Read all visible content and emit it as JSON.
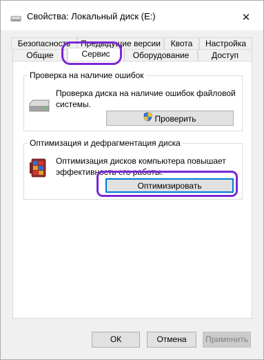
{
  "window": {
    "title": "Свойства: Локальный диск (E:)",
    "close_glyph": "✕"
  },
  "tabs": {
    "row1": [
      "Безопасность",
      "Предыдущие версии",
      "Квота",
      "Настройка"
    ],
    "row2": [
      "Общие",
      "Сервис",
      "Оборудование",
      "Доступ"
    ],
    "active": "Сервис"
  },
  "error_check": {
    "title": "Проверка на наличие ошибок",
    "description_line1": "Проверка диска на наличие ошибок файловой",
    "description_line2": "системы.",
    "button_label": "Проверить",
    "icon": "drive-icon",
    "button_icon": "uac-shield-icon"
  },
  "optimize": {
    "title": "Оптимизация и дефрагментация диска",
    "description_line1": "Оптимизация дисков компьютера повышает",
    "description_line2": "эффективность его работы.",
    "button_label": "Оптимизировать",
    "icon": "defrag-icon"
  },
  "footer": {
    "ok_label": "ОК",
    "cancel_label": "Отмена",
    "apply_label": "Применить"
  },
  "colors": {
    "highlight": "#7a26d8",
    "focus_border": "#0078d7"
  }
}
